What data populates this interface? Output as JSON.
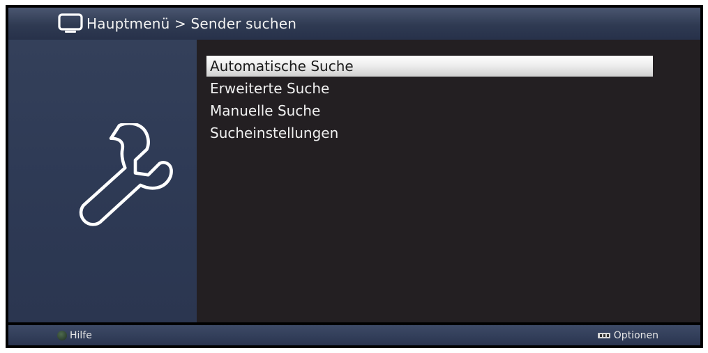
{
  "header": {
    "icon": "tv-icon",
    "breadcrumb": "Hauptmenü > Sender suchen"
  },
  "sidebar": {
    "icon": "wrench-icon"
  },
  "menu": {
    "items": [
      {
        "label": "Automatische Suche",
        "selected": true
      },
      {
        "label": "Erweiterte Suche",
        "selected": false
      },
      {
        "label": "Manuelle Suche",
        "selected": false
      },
      {
        "label": "Sucheinstellungen",
        "selected": false
      }
    ]
  },
  "footer": {
    "help": {
      "icon": "green-button-icon",
      "label": "Hilfe"
    },
    "options": {
      "icon": "option-key-icon",
      "label": "Optionen"
    }
  },
  "colors": {
    "header": "#2f3a52",
    "sidebar": "#2e3a55",
    "main": "#231f22",
    "selection": "#ececec"
  }
}
